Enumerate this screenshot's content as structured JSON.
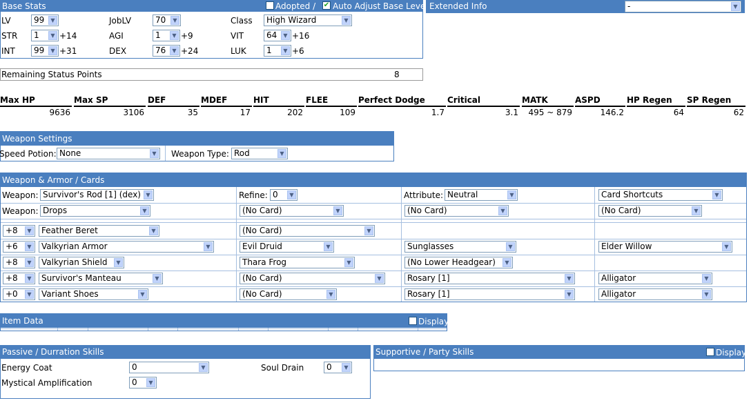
{
  "base_stats": {
    "title": "Base Stats",
    "adopted_label": "Adopted /",
    "auto_adjust_label": "Auto Adjust Base Level",
    "adopted_checked": false,
    "auto_adjust_checked": true,
    "lv_label": "LV",
    "lv_value": "99",
    "joblv_label": "JobLV",
    "joblv_value": "70",
    "class_label": "Class",
    "class_value": "High Wizard",
    "str_label": "STR",
    "str_value": "1",
    "str_bonus": "+14",
    "agi_label": "AGI",
    "agi_value": "1",
    "agi_bonus": "+9",
    "vit_label": "VIT",
    "vit_value": "64",
    "vit_bonus": "+16",
    "int_label": "INT",
    "int_value": "99",
    "int_bonus": "+31",
    "dex_label": "DEX",
    "dex_value": "76",
    "dex_bonus": "+24",
    "luk_label": "LUK",
    "luk_value": "1",
    "luk_bonus": "+6"
  },
  "extended_info": {
    "title": "Extended Info",
    "value": "-"
  },
  "remaining": {
    "label": "Remaining Status Points",
    "value": "8"
  },
  "stats": {
    "max_hp_label": "Max HP",
    "max_hp": "9636",
    "max_sp_label": "Max SP",
    "max_sp": "3106",
    "def_label": "DEF",
    "def": "35",
    "mdef_label": "MDEF",
    "mdef": "17",
    "hit_label": "HIT",
    "hit": "202",
    "flee_label": "FLEE",
    "flee": "109",
    "pdodge_label": "Perfect Dodge",
    "pdodge": "1.7",
    "crit_label": "Critical",
    "crit": "3.1",
    "matk_label": "MATK",
    "matk": "495 ~ 879",
    "aspd_label": "ASPD",
    "aspd": "146.2",
    "hpregen_label": "HP Regen",
    "hpregen": "64",
    "spregen_label": "SP Regen",
    "spregen": "62"
  },
  "weapon_settings": {
    "title": "Weapon Settings",
    "speed_label": "Speed Potion:",
    "speed_value": "None",
    "type_label": "Weapon Type:",
    "type_value": "Rod"
  },
  "equipment": {
    "title": "Weapon & Armor / Cards",
    "weapon_label": "Weapon:",
    "weapon_value": "Survivor's Rod [1] (dex)",
    "refine_label": "Refine:",
    "refine_value": "0",
    "attribute_label": "Attribute:",
    "attribute_value": "Neutral",
    "card_shortcuts": "Card Shortcuts",
    "weapon2_label": "Weapon:",
    "weapon2_value": "Drops",
    "wcard1": "(No Card)",
    "wcard2": "(No Card)",
    "wcard3": "(No Card)",
    "rows": [
      {
        "refine": "+8",
        "item": "Feather Beret",
        "card": "(No Card)",
        "extra": "",
        "extra2": ""
      },
      {
        "refine": "+6",
        "item": "Valkyrian Armor",
        "card": "Evil Druid",
        "extra": "Sunglasses",
        "extra2": "Elder Willow"
      },
      {
        "refine": "+8",
        "item": "Valkyrian Shield",
        "card": "Thara Frog",
        "extra": "(No Lower Headgear)",
        "extra2": ""
      },
      {
        "refine": "+8",
        "item": "Survivor's Manteau",
        "card": "(No Card)",
        "extra": "Rosary [1]",
        "extra2": "Alligator"
      },
      {
        "refine": "+0",
        "item": "Variant Shoes",
        "card": "(No Card)",
        "extra": "Rosary [1]",
        "extra2": "Alligator"
      }
    ]
  },
  "item_data": {
    "title": "Item Data",
    "display_label": "Display"
  },
  "passive": {
    "title": "Passive / Durration Skills",
    "energy_coat_label": "Energy Coat",
    "energy_coat_value": "0",
    "soul_drain_label": "Soul Drain",
    "soul_drain_value": "0",
    "mystical_label": "Mystical Amplification",
    "mystical_value": "0"
  },
  "supportive": {
    "title": "Supportive / Party Skills",
    "display_label": "Display"
  }
}
